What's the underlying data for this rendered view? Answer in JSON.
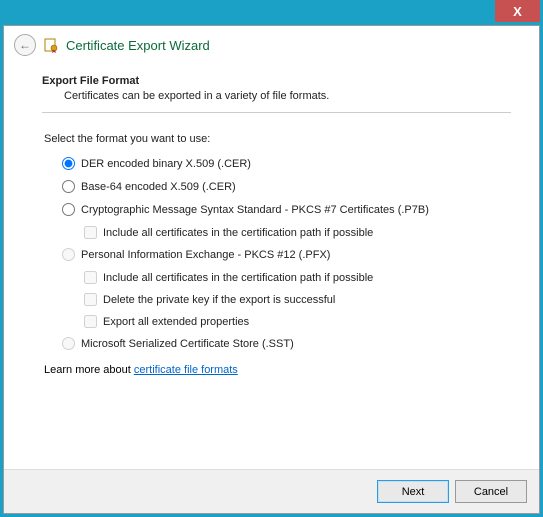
{
  "window": {
    "close": "X",
    "back_arrow": "←",
    "title": "Certificate Export Wizard"
  },
  "section": {
    "title": "Export File Format",
    "subtitle": "Certificates can be exported in a variety of file formats."
  },
  "prompt": "Select the format you want to use:",
  "options": {
    "der": "DER encoded binary X.509 (.CER)",
    "base64": "Base-64 encoded X.509 (.CER)",
    "pkcs7": "Cryptographic Message Syntax Standard - PKCS #7 Certificates (.P7B)",
    "pkcs7_include": "Include all certificates in the certification path if possible",
    "pfx": "Personal Information Exchange - PKCS #12 (.PFX)",
    "pfx_include": "Include all certificates in the certification path if possible",
    "pfx_delete": "Delete the private key if the export is successful",
    "pfx_ext": "Export all extended properties",
    "sst": "Microsoft Serialized Certificate Store (.SST)"
  },
  "learn": {
    "prefix": "Learn more about ",
    "link": "certificate file formats"
  },
  "footer": {
    "next": "Next",
    "cancel": "Cancel"
  }
}
